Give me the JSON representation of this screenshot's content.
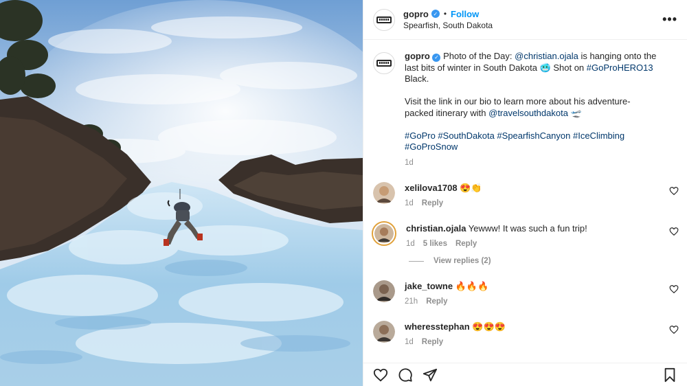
{
  "header": {
    "username": "gopro",
    "follow_label": "Follow",
    "dot": "•",
    "location": "Spearfish, South Dakota",
    "more_label": "•••"
  },
  "caption": {
    "username": "gopro",
    "text_1": " Photo of the Day: ",
    "mention_1": "@christian.ojala",
    "text_2": " is hanging onto the last bits of winter in South Dakota 🥶 Shot on ",
    "hashtag_hero": "#GoProHERO13",
    "text_3": " Black.",
    "text_4": "Visit the link in our bio to learn more about his adventure-packed itinerary with ",
    "mention_2": "@travelsouthdakota",
    "text_5": " 🛫",
    "hashtags": "#GoPro #SouthDakota #SpearfishCanyon #IceClimbing #GoProSnow",
    "time": "1d"
  },
  "comments": [
    {
      "user": "xelilova1708",
      "text": " 😍👏",
      "time": "1d",
      "likes": "",
      "reply": "Reply",
      "avatar_color": "#c9a27a"
    },
    {
      "user": "christian.ojala",
      "text": " Yewww! It was such a fun trip!",
      "time": "1d",
      "likes": "5 likes",
      "reply": "Reply",
      "avatar_color": "#9c7b5c"
    },
    {
      "user": "jake_towne",
      "text": " 🔥🔥🔥",
      "time": "21h",
      "likes": "",
      "reply": "Reply",
      "avatar_color": "#6d5a4a"
    },
    {
      "user": "wheresstephan",
      "text": " 😍😍😍",
      "time": "1d",
      "likes": "",
      "reply": "Reply",
      "avatar_color": "#8a7865"
    }
  ],
  "view_replies": "View replies (2)",
  "colors": {
    "follow": "#0095f6",
    "link": "#00376b",
    "muted": "#8e8e8e",
    "verified": "#3897f0"
  },
  "icons": [
    "verified-badge-icon",
    "more-options-icon",
    "heart-icon",
    "comment-icon",
    "share-icon",
    "save-bookmark-icon"
  ]
}
